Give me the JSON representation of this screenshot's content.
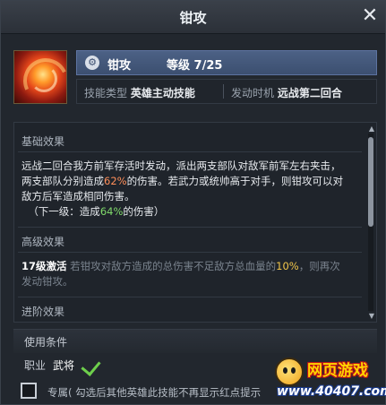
{
  "window": {
    "title": "钳攻",
    "close_symbol": "✕"
  },
  "skill": {
    "name": "钳攻",
    "level_label": "等级",
    "level_value": "7/25",
    "type_label": "技能类型",
    "type_value": "英雄主动技能",
    "timing_label": "发动时机",
    "timing_value": "远战第二回合"
  },
  "basic": {
    "heading": "基础效果",
    "line1": "远战二回合我方前军存活时发动，派出两支部队对敌军前军左右夹击，",
    "line2_a": "两支部队分别造成",
    "line2_pct": "62%",
    "line2_b": "的伤害。若武力或统帅高于对手，则钳攻可以对",
    "line3": "敌方后军造成相同伤害。",
    "next_a": "（下一级：造成",
    "next_pct": "64%",
    "next_b": "的伤害）"
  },
  "advanced": {
    "heading": "高级效果",
    "unlock": "17级激活",
    "text_a": "若钳攻对敌方造成的总伤害不足敌方总血量的",
    "text_pct": "10%",
    "text_b": "，则再次",
    "text_c": "发动钳攻。"
  },
  "progression": {
    "heading": "进阶效果"
  },
  "conditions": {
    "heading": "使用条件",
    "job_label": "职业",
    "job_value": "武将"
  },
  "footer": {
    "focus_text": "专属( 勾选后其他英雄此技能不再显示红点提示"
  },
  "watermark": {
    "title": "网页游戏",
    "url": "www.40407.com"
  },
  "icons": {
    "close": "close-icon",
    "gear": "gear-icon",
    "check": "check-icon"
  }
}
